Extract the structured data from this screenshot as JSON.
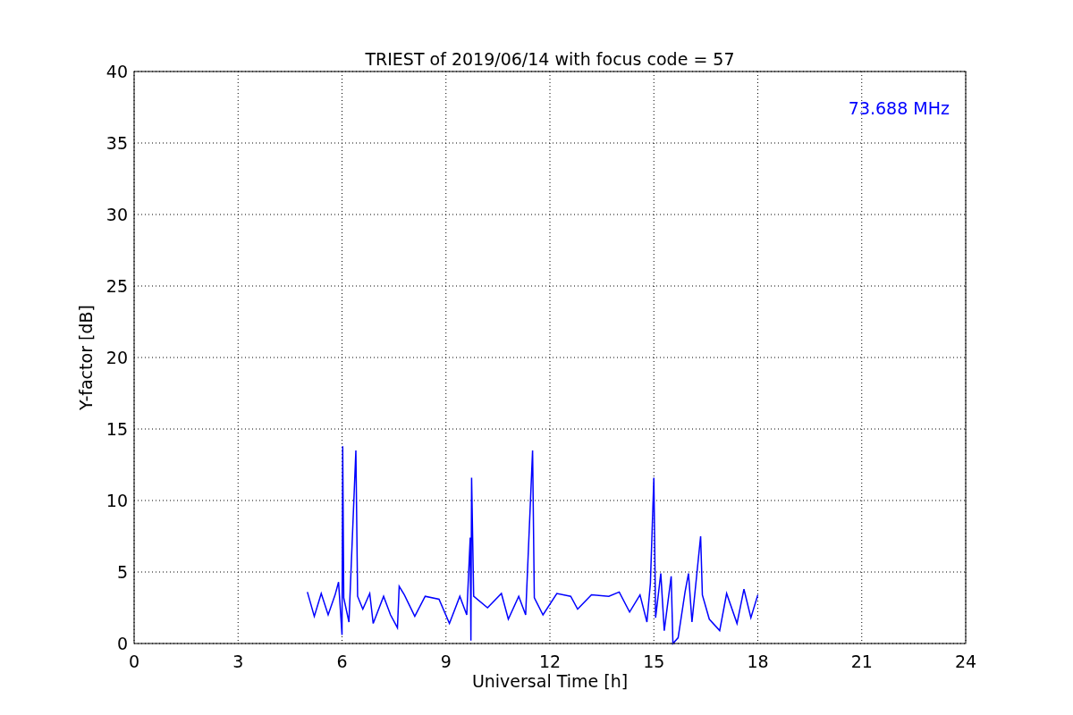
{
  "chart_data": {
    "type": "line",
    "title": "TRIEST of 2019/06/14 with focus code = 57",
    "xlabel": "Universal Time [h]",
    "ylabel": "Y-factor [dB]",
    "xlim": [
      0,
      24
    ],
    "ylim": [
      0,
      40
    ],
    "xticks": [
      0,
      3,
      6,
      9,
      12,
      15,
      18,
      21,
      24
    ],
    "yticks": [
      0,
      5,
      10,
      15,
      20,
      25,
      30,
      35,
      40
    ],
    "x": [
      5.0,
      5.2,
      5.4,
      5.6,
      5.8,
      5.9,
      6.0,
      6.02,
      6.05,
      6.2,
      6.4,
      6.45,
      6.6,
      6.8,
      6.9,
      7.2,
      7.4,
      7.6,
      7.65,
      7.8,
      8.1,
      8.4,
      8.8,
      9.1,
      9.4,
      9.6,
      9.7,
      9.72,
      9.74,
      9.8,
      10.2,
      10.6,
      10.8,
      11.1,
      11.3,
      11.5,
      11.55,
      11.8,
      12.2,
      12.6,
      12.8,
      13.2,
      13.7,
      14.0,
      14.3,
      14.6,
      14.8,
      14.9,
      15.0,
      15.05,
      15.2,
      15.3,
      15.5,
      15.55,
      15.7,
      15.9,
      16.0,
      16.1,
      16.35,
      16.4,
      16.6,
      16.9,
      17.1,
      17.4,
      17.6,
      17.8,
      18.0
    ],
    "series": [
      {
        "color": "#0000ff",
        "values": [
          3.6,
          1.9,
          3.5,
          2.0,
          3.4,
          4.3,
          0.6,
          13.8,
          3.2,
          1.5,
          13.5,
          3.3,
          2.4,
          3.5,
          1.4,
          3.3,
          2.0,
          1.1,
          4.0,
          3.4,
          1.9,
          3.3,
          3.1,
          1.4,
          3.3,
          2.0,
          7.4,
          0.2,
          11.6,
          3.3,
          2.5,
          3.5,
          1.7,
          3.3,
          2.0,
          13.5,
          3.2,
          2.0,
          3.5,
          3.3,
          2.4,
          3.4,
          3.3,
          3.6,
          2.2,
          3.4,
          1.5,
          4.2,
          11.6,
          1.8,
          4.9,
          0.9,
          4.7,
          0.0,
          0.4,
          3.6,
          4.9,
          1.5,
          7.5,
          3.4,
          1.7,
          0.9,
          3.5,
          1.4,
          3.8,
          1.8,
          3.4
        ]
      }
    ],
    "grid": true,
    "annotations": [
      {
        "text": "73.688 MHz"
      }
    ]
  }
}
